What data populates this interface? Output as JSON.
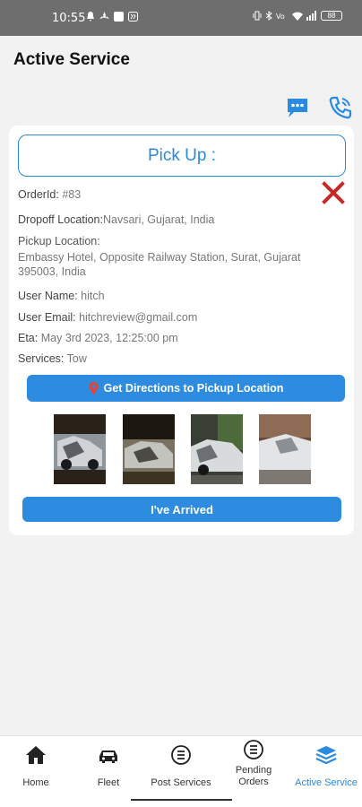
{
  "status_bar": {
    "time": "10:55",
    "battery": "88"
  },
  "page": {
    "title": "Active Service"
  },
  "card": {
    "heading": "Pick Up :",
    "order_label": "OrderId:",
    "order_value": "#83",
    "dropoff_label": "Dropoff Location:",
    "dropoff_value": "Navsari, Gujarat, India",
    "pickup_label": "Pickup Location:",
    "pickup_line1": "Embassy Hotel, Opposite Railway Station, Surat, Gujarat",
    "pickup_line2": "395003, India",
    "username_label": "User Name:",
    "username_value": "hitch",
    "email_label": "User Email:",
    "email_value": "hitchreview@gmail.com",
    "eta_label": "Eta:",
    "eta_value": "May 3rd 2023, 12:25:00 pm",
    "services_label": "Services:",
    "services_value": "Tow",
    "directions_button": "Get Directions to Pickup Location",
    "arrived_button": "I've Arrived"
  },
  "colors": {
    "accent": "#2d8ce0",
    "close": "#c62828"
  },
  "nav": {
    "items": [
      {
        "label": "Home",
        "icon": "home-icon"
      },
      {
        "label": "Fleet",
        "icon": "car-icon"
      },
      {
        "label": "Post Services",
        "icon": "list-icon"
      },
      {
        "label": "Pending Orders",
        "icon": "list-icon"
      },
      {
        "label": "Active Service",
        "icon": "layers-icon"
      }
    ]
  }
}
